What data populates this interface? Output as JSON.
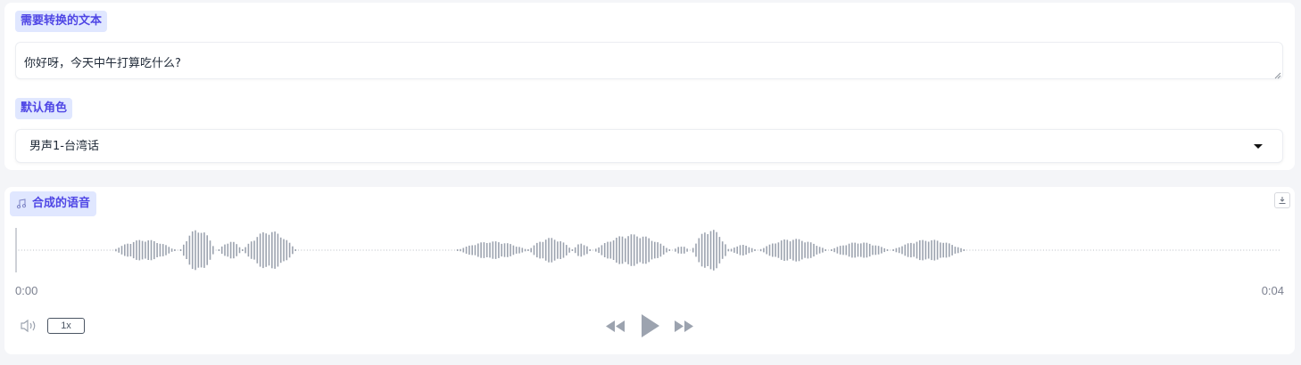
{
  "input_section": {
    "text_label": "需要转换的文本",
    "text_value": "你好呀，今天中午打算吃什么?",
    "role_label": "默认角色",
    "role_selected": "男声1-台湾话"
  },
  "audio_section": {
    "label": "合成的语音",
    "time_start": "0:00",
    "time_end": "0:04",
    "playback_rate": "1x",
    "playback_progress": 0
  },
  "icons": {
    "audio_label": "music-note-icon",
    "download": "download-icon",
    "volume": "volume-icon",
    "rewind": "rewind-icon",
    "play": "play-icon",
    "forward": "fast-forward-icon",
    "dropdown": "caret-down-icon"
  },
  "colors": {
    "accent": "#4f46e5",
    "label_bg": "#e0e7ff",
    "waveform": "#9ca3af",
    "controls": "#9ca3af"
  }
}
